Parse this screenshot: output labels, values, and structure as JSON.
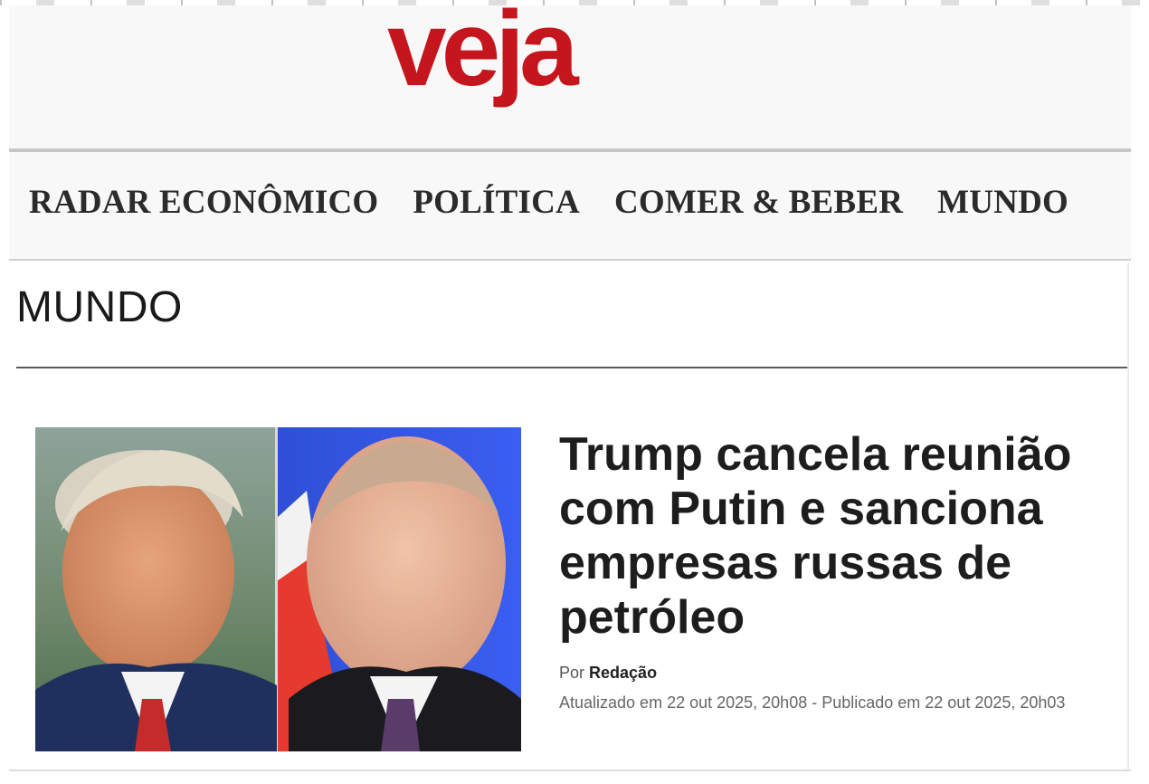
{
  "header": {
    "logo_text": "veja",
    "logo_color": "#c4161c"
  },
  "nav": {
    "items": [
      {
        "label": "RADAR ECONÔMICO"
      },
      {
        "label": "POLÍTICA"
      },
      {
        "label": "COMER & BEBER"
      },
      {
        "label": "MUNDO"
      }
    ]
  },
  "section": {
    "title": "MUNDO"
  },
  "article": {
    "headline": "Trump cancela reunião com Putin e sanciona empresas russas de petróleo",
    "byline_prefix": "Por",
    "author": "Redação",
    "dates": "Atualizado em 22 out 2025, 20h08 - Publicado em 22 out 2025, 20h03",
    "image_icon": "photo-trump-putin-icon"
  }
}
